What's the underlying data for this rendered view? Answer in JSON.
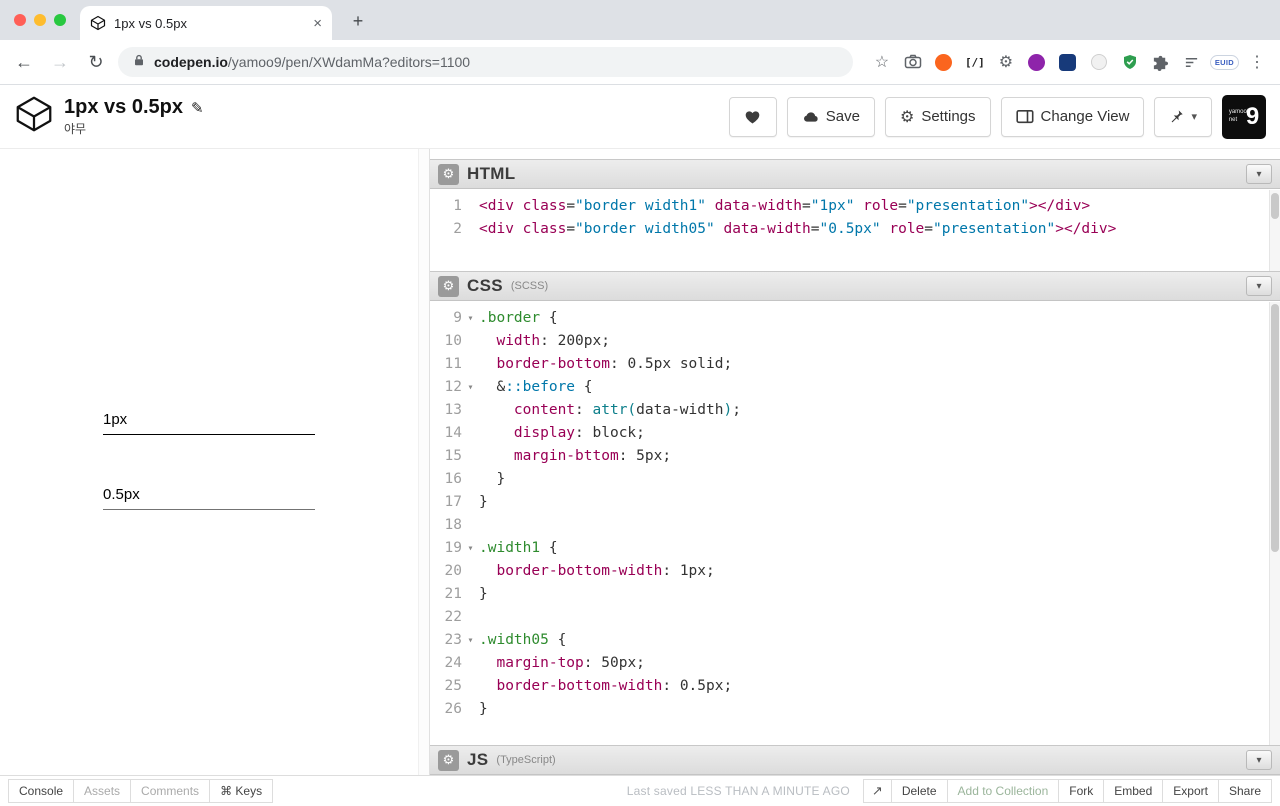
{
  "browser": {
    "tab": {
      "title": "1px vs 0.5px"
    },
    "url": {
      "domain": "codepen.io",
      "path": "/yamoo9/pen/XWdamMa?editors=1100"
    },
    "euid_label": "EUID"
  },
  "header": {
    "title": "1px vs 0.5px",
    "author": "야무",
    "save": "Save",
    "settings": "Settings",
    "change_view": "Change View",
    "avatar_big": "9",
    "avatar_small": "yamoo9 net"
  },
  "preview": {
    "labels": [
      "1px",
      "0.5px"
    ]
  },
  "editors": {
    "html": {
      "title": "HTML",
      "lines": [
        {
          "n": "1",
          "t": [
            [
              "<div",
              "tag"
            ],
            [
              " ",
              "pl"
            ],
            [
              "class",
              "attr"
            ],
            [
              "=",
              "pl"
            ],
            [
              "\"border width1\"",
              "str"
            ],
            [
              " ",
              "pl"
            ],
            [
              "data-width",
              "attr"
            ],
            [
              "=",
              "pl"
            ],
            [
              "\"1px\"",
              "str"
            ],
            [
              " ",
              "pl"
            ],
            [
              "role",
              "attr"
            ],
            [
              "=",
              "pl"
            ],
            [
              "\"presentation\"",
              "str"
            ],
            [
              "></div>",
              "tag"
            ]
          ]
        },
        {
          "n": "2",
          "t": [
            [
              "<div",
              "tag"
            ],
            [
              " ",
              "pl"
            ],
            [
              "class",
              "attr"
            ],
            [
              "=",
              "pl"
            ],
            [
              "\"border width05\"",
              "str"
            ],
            [
              " ",
              "pl"
            ],
            [
              "data-width",
              "attr"
            ],
            [
              "=",
              "pl"
            ],
            [
              "\"0.5px\"",
              "str"
            ],
            [
              " ",
              "pl"
            ],
            [
              "role",
              "attr"
            ],
            [
              "=",
              "pl"
            ],
            [
              "\"presentation\"",
              "str"
            ],
            [
              "></div>",
              "tag"
            ]
          ]
        }
      ]
    },
    "css": {
      "title": "CSS",
      "subtitle": "(SCSS)",
      "lines": [
        {
          "n": "9",
          "fold": true,
          "t": [
            [
              ".border",
              "sel"
            ],
            [
              " {",
              "pl"
            ]
          ]
        },
        {
          "n": "10",
          "t": [
            [
              "  ",
              "pl"
            ],
            [
              "width",
              "prop"
            ],
            [
              ": ",
              "pl"
            ],
            [
              "200px",
              "val"
            ],
            [
              ";",
              "pl"
            ]
          ]
        },
        {
          "n": "11",
          "t": [
            [
              "  ",
              "pl"
            ],
            [
              "border-bottom",
              "prop"
            ],
            [
              ": ",
              "pl"
            ],
            [
              "0.5px solid",
              "val"
            ],
            [
              ";",
              "pl"
            ]
          ]
        },
        {
          "n": "12",
          "fold": true,
          "t": [
            [
              "  &",
              "pl"
            ],
            [
              "::before",
              "ps"
            ],
            [
              " {",
              "pl"
            ]
          ]
        },
        {
          "n": "13",
          "t": [
            [
              "    ",
              "pl"
            ],
            [
              "content",
              "prop"
            ],
            [
              ": ",
              "pl"
            ],
            [
              "attr(",
              "fn"
            ],
            [
              "data-width",
              "val"
            ],
            [
              ")",
              "fn"
            ],
            [
              ";",
              "pl"
            ]
          ]
        },
        {
          "n": "14",
          "t": [
            [
              "    ",
              "pl"
            ],
            [
              "display",
              "prop"
            ],
            [
              ": ",
              "pl"
            ],
            [
              "block",
              "val"
            ],
            [
              ";",
              "pl"
            ]
          ]
        },
        {
          "n": "15",
          "t": [
            [
              "    ",
              "pl"
            ],
            [
              "margin-bttom",
              "prop"
            ],
            [
              ": ",
              "pl"
            ],
            [
              "5px",
              "val"
            ],
            [
              ";",
              "pl"
            ]
          ]
        },
        {
          "n": "16",
          "t": [
            [
              "  }",
              "pl"
            ]
          ]
        },
        {
          "n": "17",
          "t": [
            [
              "}",
              "pl"
            ]
          ]
        },
        {
          "n": "18",
          "t": []
        },
        {
          "n": "19",
          "fold": true,
          "t": [
            [
              ".width1",
              "sel"
            ],
            [
              " {",
              "pl"
            ]
          ]
        },
        {
          "n": "20",
          "t": [
            [
              "  ",
              "pl"
            ],
            [
              "border-bottom-width",
              "prop"
            ],
            [
              ": ",
              "pl"
            ],
            [
              "1px",
              "val"
            ],
            [
              ";",
              "pl"
            ]
          ]
        },
        {
          "n": "21",
          "t": [
            [
              "}",
              "pl"
            ]
          ]
        },
        {
          "n": "22",
          "t": []
        },
        {
          "n": "23",
          "fold": true,
          "t": [
            [
              ".width05",
              "sel"
            ],
            [
              " {",
              "pl"
            ]
          ]
        },
        {
          "n": "24",
          "t": [
            [
              "  ",
              "pl"
            ],
            [
              "margin-top",
              "prop"
            ],
            [
              ": ",
              "pl"
            ],
            [
              "50px",
              "val"
            ],
            [
              ";",
              "pl"
            ]
          ]
        },
        {
          "n": "25",
          "t": [
            [
              "  ",
              "pl"
            ],
            [
              "border-bottom-width",
              "prop"
            ],
            [
              ": ",
              "pl"
            ],
            [
              "0.5px",
              "val"
            ],
            [
              ";",
              "pl"
            ]
          ]
        },
        {
          "n": "26",
          "t": [
            [
              "}",
              "pl"
            ]
          ]
        }
      ]
    },
    "js": {
      "title": "JS",
      "subtitle": "(TypeScript)"
    }
  },
  "footer": {
    "console": "Console",
    "assets": "Assets",
    "comments": "Comments",
    "keys": "⌘ Keys",
    "last_saved": "Last saved LESS THAN A MINUTE AGO",
    "delete": "Delete",
    "add_to_collection": "Add to Collection",
    "fork": "Fork",
    "embed": "Embed",
    "export": "Export",
    "share": "Share"
  },
  "colors": {
    "syntax_tag": "#990055",
    "syntax_string": "#0077aa",
    "syntax_selector": "#2e8b2e",
    "syntax_property": "#990055",
    "accent_orange_ext": "#fb651e",
    "shield_green": "#2e9e4f"
  }
}
